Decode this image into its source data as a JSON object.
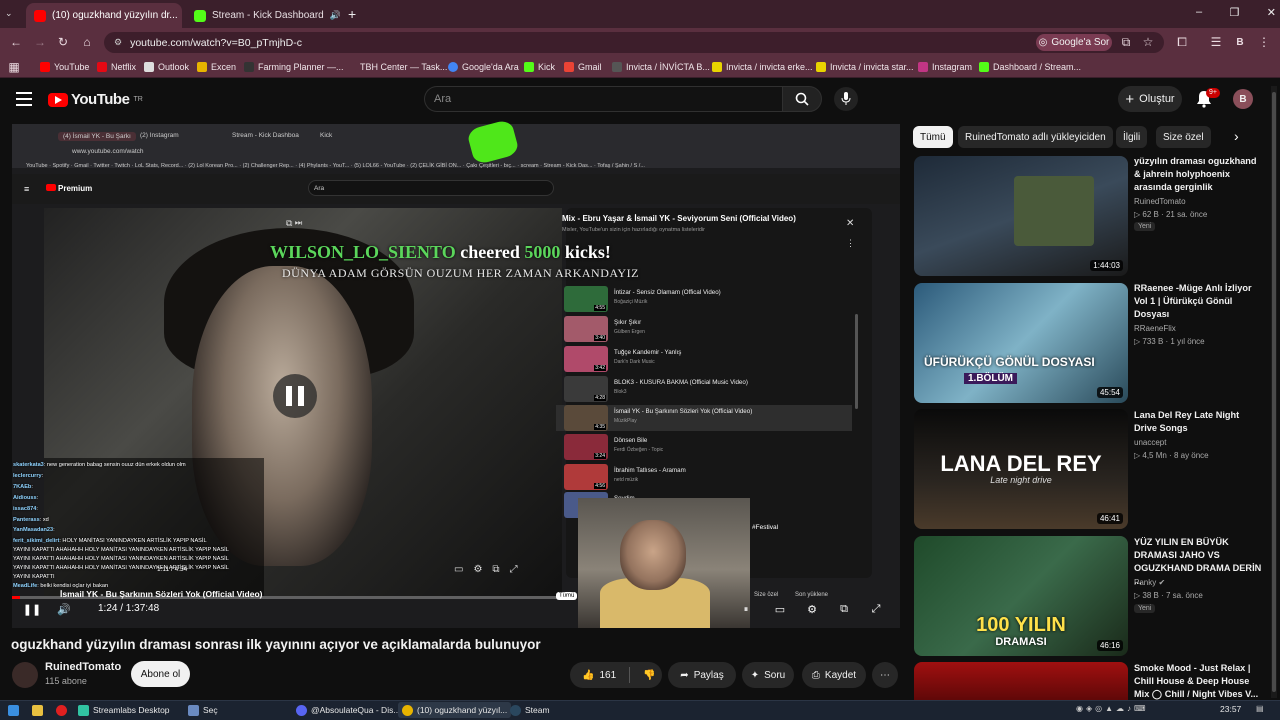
{
  "browser": {
    "tabs": [
      {
        "label": "(10) oguzkhand yüzyılın dr...",
        "active": true,
        "color": "#ff0000"
      },
      {
        "label": "Stream - Kick Dashboard",
        "active": false,
        "color": "#53fc18"
      }
    ],
    "url": "youtube.com/watch?v=B0_pTmjhD-c",
    "google_sor": "Google'a Sor",
    "profile_initial": "B",
    "bookmarks": [
      "YouTube",
      "Netflix",
      "Outlook",
      "Excen",
      "Farming Planner —...",
      "TBH Center — Task...",
      "Google'da Ara",
      "Kick",
      "Gmail",
      "Invicta / İNVİCTA B...",
      "Invicta / invicta erke...",
      "Invicta / invicta star...",
      "Instagram",
      "Dashboard / Stream..."
    ]
  },
  "header": {
    "logo_text": "YouTube",
    "logo_sup": "TR",
    "search_placeholder": "Ara",
    "create_label": "Oluştur",
    "notif_count": "9+",
    "avatar_initial": "B"
  },
  "player": {
    "inner_tabs": [
      "(4) İsmail YK - Bu Şarkı",
      "(2) Instagram",
      "Stream - Kick Dashboa",
      "Kick"
    ],
    "inner_url": "www.youtube.com/watch",
    "inner_bookmarks": [
      "YouTube",
      "Spotify",
      "Gmail",
      "Twitter",
      "Twitch",
      "LoL Stats, Record...",
      "(2) Lol Korean Pro...",
      "(2) Challenger Rep...",
      "(4) Phylants - YouT...",
      "(5) LOL66 - YouTube",
      "(2) ÇELİK GİBİ ON...",
      "Çakı Çeşitleri - bıç...",
      "scream",
      "Stream - Kick Das...",
      "Tofaş / Şahin / S /..."
    ],
    "inner_logo": "Premium",
    "inner_search": "Ara",
    "cheer": {
      "user": "WILSON_LO_SIENTO",
      "mid": "cheered",
      "amount": "5000",
      "end": "kicks!"
    },
    "cheer_message": "DÜNYA ADAM GÖRSÜN OUZUM HER ZAMAN ARKANDAYIZ",
    "inner_time": "1:11 / 4:34",
    "inner_caption": "İsmail YK - Bu Şarkının Sözleri Yok (Official Video)",
    "time": "1:24 / 1:37:48",
    "progress": 0.014,
    "festival_tag": "#Festival",
    "tumu_chip": "Tümü",
    "size_ozel": "Size özel",
    "son_yuklenen": "Son yüklene"
  },
  "playlist": {
    "title": "Mix - Ebru Yaşar & İsmail YK - Seviyorum Seni (Official Video)",
    "subtitle": "Mixler, YouTube'un sizin için hazırladığı oynatma listeleridir",
    "items": [
      {
        "title": "İntizar - Sensiz Olamam (Offical Video)",
        "channel": "Boğaziçi Müzik",
        "duration": "4:55",
        "color": "#2e6b3a"
      },
      {
        "title": "Şıkır Şıkır",
        "channel": "Gülben Ergen",
        "duration": "3:40",
        "color": "#a35a6a"
      },
      {
        "title": "Tuğçe Kandemir - Yanlış",
        "channel": "Dark'n Dark Music",
        "duration": "3:42",
        "color": "#b04a6a"
      },
      {
        "title": "BLOK3 - KUSURA BAKMA (Official Music Video)",
        "channel": "Blok3",
        "duration": "4:28",
        "color": "#3a3a3a"
      },
      {
        "title": "İsmail YK - Bu Şarkının Sözleri Yok (Official Video)",
        "channel": "MüzikPlay",
        "duration": "4:35",
        "color": "#5a4a3a",
        "selected": true
      },
      {
        "title": "Dönsen Bile",
        "channel": "Ferdi Özbeğen - Topic",
        "duration": "3:24",
        "color": "#8a2a3a"
      },
      {
        "title": "İbrahim Tatlıses - Aramam",
        "channel": "netd müzik",
        "duration": "4:56",
        "color": "#b03a3a"
      },
      {
        "title": "Sevdim",
        "channel": "",
        "duration": "",
        "color": "#4a5a8a"
      }
    ]
  },
  "chat": [
    {
      "user": "skaterkata3",
      "msg": ": new generation babag sensin ouuz dün erkek oldun olm"
    },
    {
      "user": "leclercurry",
      "msg": ":"
    },
    {
      "user": "7KAEb",
      "msg": ":"
    },
    {
      "user": "Aidiouss",
      "msg": ":"
    },
    {
      "user": "issac874",
      "msg": ":"
    },
    {
      "user": "Panterass",
      "msg": ": xd"
    },
    {
      "user": "YanMasadan23",
      "msg": ":"
    },
    {
      "user": "ferit_sikimi_delirt",
      "msg": ": HOLY MANİTASI YANINDAYKEN ARTİSLİK YAPIP NASİL"
    },
    {
      "user": "",
      "msg": "YAYINI KAPATTI AHAHAHH HOLY MANİTASI YANINDAYKEN ARTİSLİK YAPIP NASİL"
    },
    {
      "user": "",
      "msg": "YAYINI KAPATTI AHAHAHH HOLY MANİTASI YANINDAYKEN ARTİSLİK YAPIP NASİL"
    },
    {
      "user": "",
      "msg": "YAYINI KAPATTI AHAHAHH HOLY MANİTASI YANINDAYKEN ARTİSLİK YAPIP NASİL"
    },
    {
      "user": "",
      "msg": "YAYINI KAPATTI"
    },
    {
      "user": "MeadLife",
      "msg": ": belki kendisi oçlar iyi bakan"
    }
  ],
  "video": {
    "title": "oguzkhand yüzyılın draması sonrası ilk yayınını açıyor ve açıklamalarda bulunuyor",
    "channel": "RuinedTomato",
    "subscribers": "115 abone",
    "subscribe_label": "Abone ol",
    "likes": "161",
    "share_label": "Paylaş",
    "ask_label": "Soru",
    "save_label": "Kaydet"
  },
  "sidebar": {
    "chips": [
      "Tümü",
      "RuinedTomato adlı yükleyiciden",
      "İlgili",
      "Size özel"
    ],
    "recs": [
      {
        "title": "yüzyılın draması oguzkhand & jahrein holyphoenix arasında gerginlik",
        "channel": "RuinedTomato",
        "meta": "62 B · 21 sa. önce",
        "badge": "Yeni",
        "duration": "1:44:03",
        "color": "#2a3a4a"
      },
      {
        "title": "RRaenee -Müge Anlı İzliyor Vol 1 | Üfürükçü Gönül Dosyası",
        "channel": "RRaeneFlix",
        "meta": "733 B · 1 yıl önce",
        "badge": "",
        "duration": "45:54",
        "color": "#3a6a8a",
        "overlay": "ÜFÜRÜKÇÜ GÖNÜL DOSYASI",
        "overlay2": "1.BÖLÜM"
      },
      {
        "title": "Lana Del Rey Late Night Drive Songs",
        "channel": "unaccept",
        "meta": "4,5 Mn · 8 ay önce",
        "badge": "",
        "duration": "46:41",
        "color": "#1a1a1a",
        "overlay": "LANA DEL REY",
        "overlay2": "Late night drive"
      },
      {
        "title": "YÜZ YILIN EN BÜYÜK DRAMASI JAHO VS OGUZKHAND DRAMA DERİN ...",
        "channel": "Panky",
        "meta": "38 B · 7 sa. önce",
        "badge": "Yeni",
        "duration": "46:16",
        "color": "#2a5a3a",
        "overlay": "100 YILIN",
        "overlay2": "DRAMASI"
      },
      {
        "title": "Smoke Mood - Just Relax | Chill House & Deep House Mix ◯ Chill / Night Vibes V...",
        "channel": "",
        "meta": "",
        "badge": "",
        "duration": "",
        "color": "#8a1010"
      }
    ]
  },
  "taskbar": {
    "apps": [
      "Streamlabs Desktop",
      "Seç",
      "@AbsoulateQua - Dis...",
      "(10) oguzkhand yüzyıl...",
      "Steam"
    ],
    "time": "23:57"
  }
}
